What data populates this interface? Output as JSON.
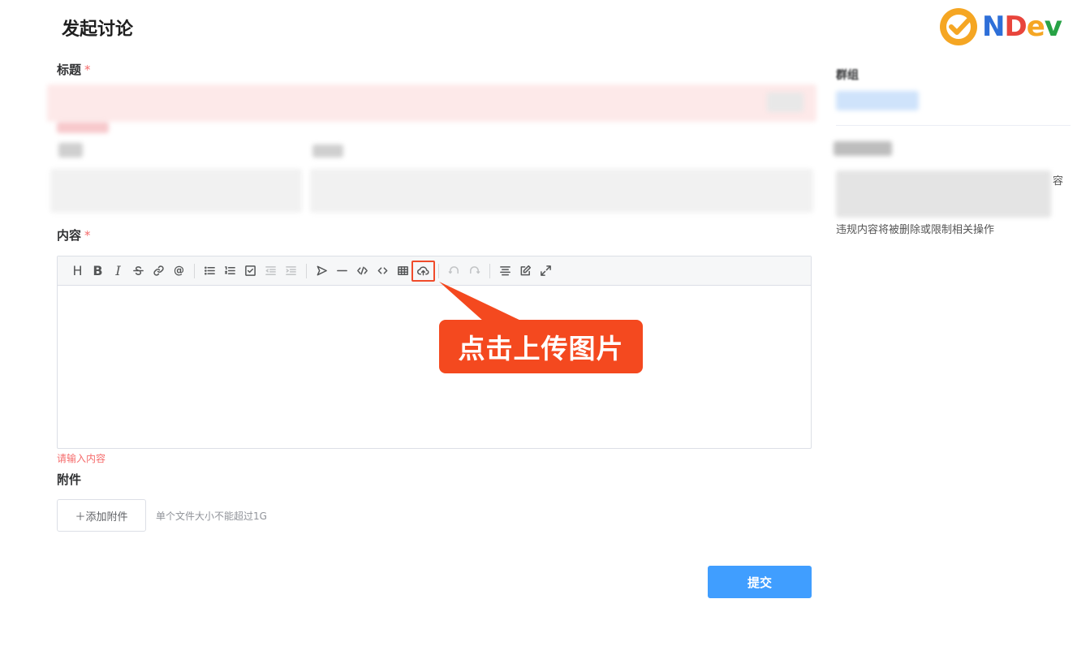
{
  "page": {
    "title": "发起讨论"
  },
  "logo": {
    "text_n": "N",
    "text_d": "D",
    "text_e": "e",
    "text_v": "v"
  },
  "form": {
    "title_label": "标题",
    "content_label": "内容",
    "required_mark": "*",
    "content_error": "请输入内容",
    "attachment_label": "附件",
    "add_attachment_button": "＋添加附件",
    "attachment_hint": "单个文件大小不能超过1G",
    "submit_button": "提交"
  },
  "editor": {
    "toolbar": {
      "heading": "H",
      "bold": "B",
      "italic": "I",
      "mention": "@"
    }
  },
  "annotation": {
    "callout_text": "点击上传图片"
  },
  "sidebar": {
    "group_label": "群组",
    "fragment_text": "容",
    "note": "违规内容将被删除或限制相关操作"
  },
  "colors": {
    "primary": "#409eff",
    "required": "#f56c6c",
    "callout": "#f4491f"
  }
}
